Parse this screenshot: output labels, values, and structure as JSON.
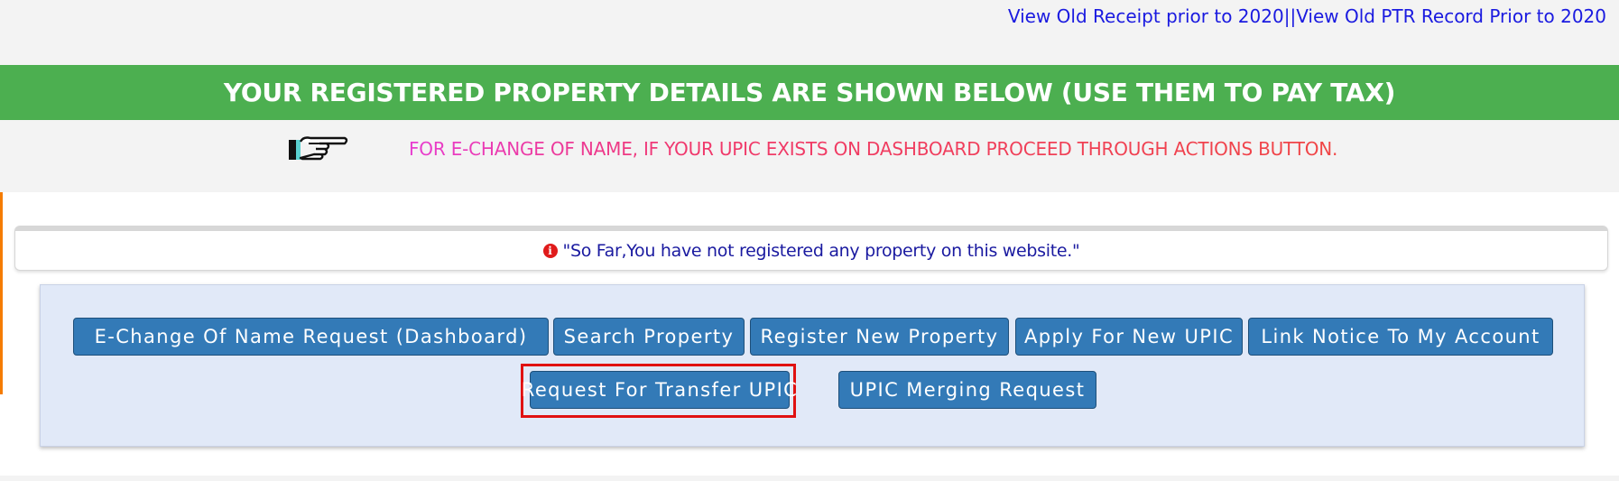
{
  "top_links": {
    "old_receipt": "View Old Receipt prior to 2020",
    "separator": "||",
    "old_ptr": "View Old PTR Record Prior to 2020"
  },
  "banner": {
    "title": "YOUR REGISTERED PROPERTY DETAILS ARE SHOWN BELOW (USE THEM TO PAY TAX)",
    "color": "#4caf50"
  },
  "notice": {
    "icon": "pointing-hand-icon",
    "text": "FOR E-CHANGE OF NAME, IF YOUR UPIC EXISTS ON DASHBOARD PROCEED THROUGH ACTIONS BUTTON."
  },
  "alert": {
    "icon": "info-icon",
    "icon_glyph": "i",
    "message": "\"So Far,You have not registered any property on this website.\""
  },
  "buttons": {
    "echange_dashboard": "E-Change Of Name Request (Dashboard)",
    "search_property": "Search Property",
    "register_property": "Register New Property",
    "apply_upic": "Apply For New UPIC",
    "link_notice": "Link Notice To My Account",
    "transfer_upic": "Request For Transfer UPIC",
    "merging_request": "UPIC Merging Request",
    "color": "#337ab7"
  },
  "highlight": {
    "target": "transfer_upic",
    "color": "#e01111"
  }
}
